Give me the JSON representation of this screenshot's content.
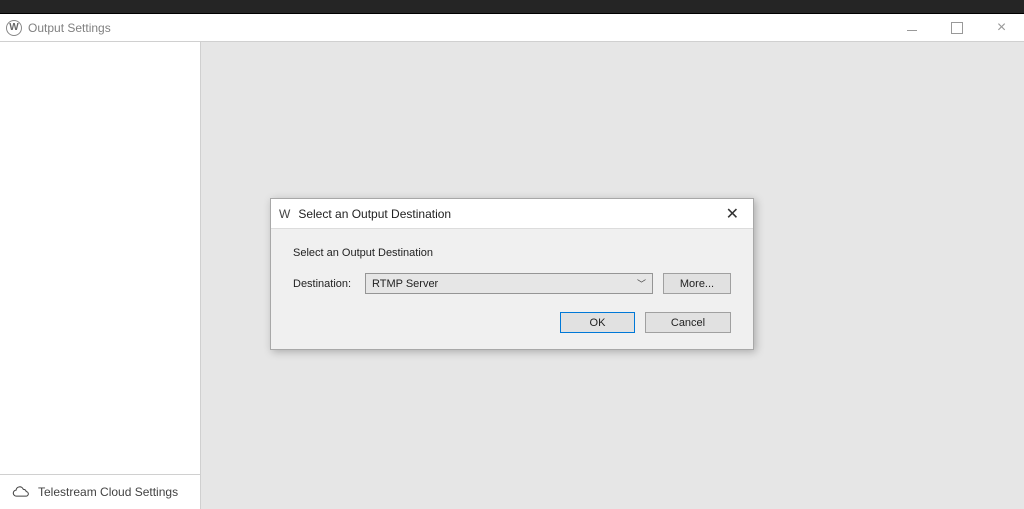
{
  "window": {
    "title": "Output Settings"
  },
  "sidebar": {
    "cloud_settings_label": "Telestream Cloud Settings"
  },
  "dialog": {
    "title": "Select an Output Destination",
    "subtitle": "Select an Output Destination",
    "destination_label": "Destination:",
    "destination_value": "RTMP Server",
    "more_label": "More...",
    "ok_label": "OK",
    "cancel_label": "Cancel"
  }
}
